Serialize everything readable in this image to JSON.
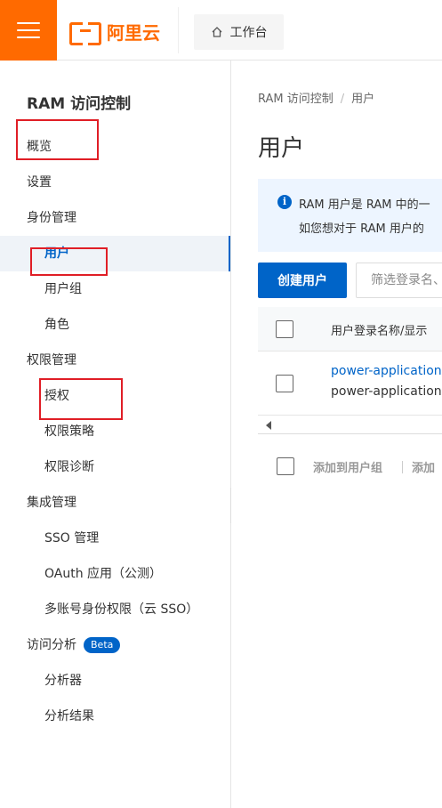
{
  "topbar": {
    "brand": "阿里云",
    "workbench_label": "工作台"
  },
  "sidebar": {
    "title": "RAM 访问控制",
    "items": [
      {
        "label": "概览"
      },
      {
        "label": "设置"
      },
      {
        "label": "身份管理"
      },
      {
        "label": "用户"
      },
      {
        "label": "用户组"
      },
      {
        "label": "角色"
      },
      {
        "label": "权限管理"
      },
      {
        "label": "授权"
      },
      {
        "label": "权限策略"
      },
      {
        "label": "权限诊断"
      },
      {
        "label": "集成管理"
      },
      {
        "label": "SSO 管理"
      },
      {
        "label": "OAuth 应用（公测）"
      },
      {
        "label": "多账号身份权限（云 SSO）"
      },
      {
        "label": "访问分析",
        "badge": "Beta"
      },
      {
        "label": "分析器"
      },
      {
        "label": "分析结果"
      }
    ],
    "active_item": "用户"
  },
  "main": {
    "breadcrumb": [
      "RAM 访问控制",
      "用户"
    ],
    "title": "用户",
    "alert": {
      "line1": "RAM 用户是 RAM 中的一",
      "line2": "如您想对于 RAM 用户的"
    },
    "create_button": "创建用户",
    "filter_placeholder": "筛选登录名、",
    "table": {
      "column_header": "用户登录名称/显示",
      "rows": [
        {
          "login_name": "power-application-",
          "display_name": "power-application-"
        }
      ]
    },
    "batch_actions": [
      "添加到用户组",
      "添加"
    ]
  },
  "colors": {
    "brand": "#ff6a00",
    "primary": "#0064c8",
    "highlight_box": "#e01e26"
  }
}
